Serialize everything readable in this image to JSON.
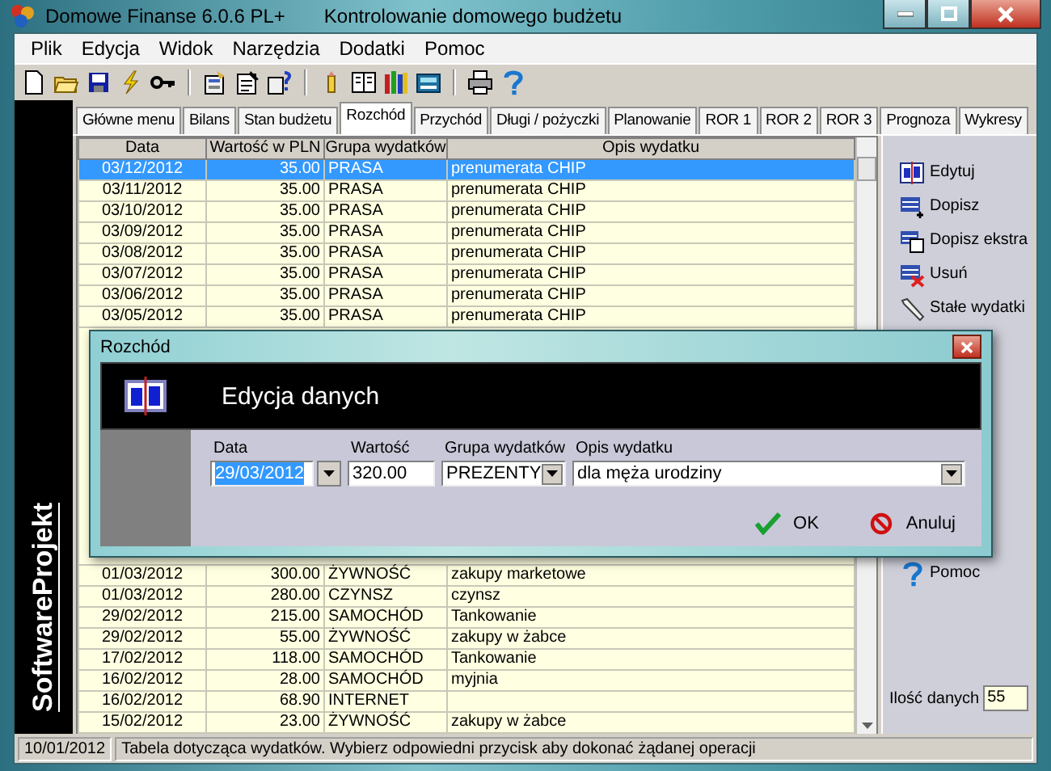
{
  "window": {
    "title": "Domowe Finanse 6.0.6 PL+",
    "subtitle": "Kontrolowanie domowego budżetu"
  },
  "menu": [
    "Plik",
    "Edycja",
    "Widok",
    "Narzędzia",
    "Dodatki",
    "Pomoc"
  ],
  "brand": "SoftwareProjekt",
  "tabs": [
    {
      "label": "Główne menu",
      "selected": false
    },
    {
      "label": "Bilans",
      "selected": false
    },
    {
      "label": "Stan budżetu",
      "selected": false
    },
    {
      "label": "Rozchód",
      "selected": true
    },
    {
      "label": "Przychód",
      "selected": false
    },
    {
      "label": "Długi / pożyczki",
      "selected": false
    },
    {
      "label": "Planowanie",
      "selected": false
    },
    {
      "label": "ROR 1",
      "selected": false
    },
    {
      "label": "ROR 2",
      "selected": false
    },
    {
      "label": "ROR 3",
      "selected": false
    },
    {
      "label": "Prognoza",
      "selected": false
    },
    {
      "label": "Wykresy",
      "selected": false
    }
  ],
  "table": {
    "columns": [
      "Data",
      "Wartość w PLN",
      "Grupa wydatków",
      "Opis wydatku"
    ],
    "rows_top": [
      {
        "date": "03/12/2012",
        "value": "35.00",
        "group": "PRASA",
        "description": "prenumerata CHIP",
        "selected": true
      },
      {
        "date": "03/11/2012",
        "value": "35.00",
        "group": "PRASA",
        "description": "prenumerata CHIP",
        "selected": false
      },
      {
        "date": "03/10/2012",
        "value": "35.00",
        "group": "PRASA",
        "description": "prenumerata CHIP",
        "selected": false
      },
      {
        "date": "03/09/2012",
        "value": "35.00",
        "group": "PRASA",
        "description": "prenumerata CHIP",
        "selected": false
      },
      {
        "date": "03/08/2012",
        "value": "35.00",
        "group": "PRASA",
        "description": "prenumerata CHIP",
        "selected": false
      },
      {
        "date": "03/07/2012",
        "value": "35.00",
        "group": "PRASA",
        "description": "prenumerata CHIP",
        "selected": false
      },
      {
        "date": "03/06/2012",
        "value": "35.00",
        "group": "PRASA",
        "description": "prenumerata CHIP",
        "selected": false
      },
      {
        "date": "03/05/2012",
        "value": "35.00",
        "group": "PRASA",
        "description": "prenumerata CHIP",
        "selected": false
      }
    ],
    "rows_bottom": [
      {
        "date": "01/03/2012",
        "value": "300.00",
        "group": "ŻYWNOŚĆ",
        "description": "zakupy marketowe",
        "selected": false
      },
      {
        "date": "01/03/2012",
        "value": "280.00",
        "group": "CZYNSZ",
        "description": "czynsz",
        "selected": false
      },
      {
        "date": "29/02/2012",
        "value": "215.00",
        "group": "SAMOCHÓD",
        "description": "Tankowanie",
        "selected": false
      },
      {
        "date": "29/02/2012",
        "value": "55.00",
        "group": "ŻYWNOŚĆ",
        "description": "zakupy w żabce",
        "selected": false
      },
      {
        "date": "17/02/2012",
        "value": "118.00",
        "group": "SAMOCHÓD",
        "description": "Tankowanie",
        "selected": false
      },
      {
        "date": "16/02/2012",
        "value": "28.00",
        "group": "SAMOCHÓD",
        "description": "myjnia",
        "selected": false
      },
      {
        "date": "16/02/2012",
        "value": "68.90",
        "group": "INTERNET",
        "selected": false
      },
      {
        "date": "15/02/2012",
        "value": "23.00",
        "group": "ŻYWNOŚĆ",
        "description": "zakupy w żabce",
        "selected": false
      }
    ]
  },
  "actions": [
    {
      "label": "Edytuj",
      "kind": "edit"
    },
    {
      "label": "Dopisz",
      "kind": "add"
    },
    {
      "label": "Dopisz ekstra",
      "kind": "copy"
    },
    {
      "label": "Usuń",
      "kind": "delete"
    },
    {
      "label": "Stałe wydatki",
      "kind": "fixed"
    },
    {
      "label": "Pomoc",
      "kind": "help"
    }
  ],
  "count": {
    "label": "Ilość danych",
    "value": "55"
  },
  "status_bar": {
    "date": "10/01/2012",
    "message": "Tabela dotycząca wydatków. Wybierz odpowiedni przycisk aby dokonać żądanej operacji"
  },
  "dialog": {
    "title": "Rozchód",
    "heading": "Edycja danych",
    "fields": [
      {
        "label": "Data",
        "value": "29/03/2012",
        "kind": "date",
        "highlighted": true
      },
      {
        "label": "Wartość",
        "value": "320.00",
        "kind": "text",
        "highlighted": false
      },
      {
        "label": "Grupa wydatków",
        "value": "PREZENTY",
        "kind": "combo",
        "highlighted": false
      },
      {
        "label": "Opis wydatku",
        "value": "dla męża urodziny",
        "kind": "combo",
        "highlighted": false
      }
    ],
    "buttons": [
      {
        "label": "OK",
        "kind": "ok"
      },
      {
        "label": "Anuluj",
        "kind": "cancel"
      }
    ]
  }
}
